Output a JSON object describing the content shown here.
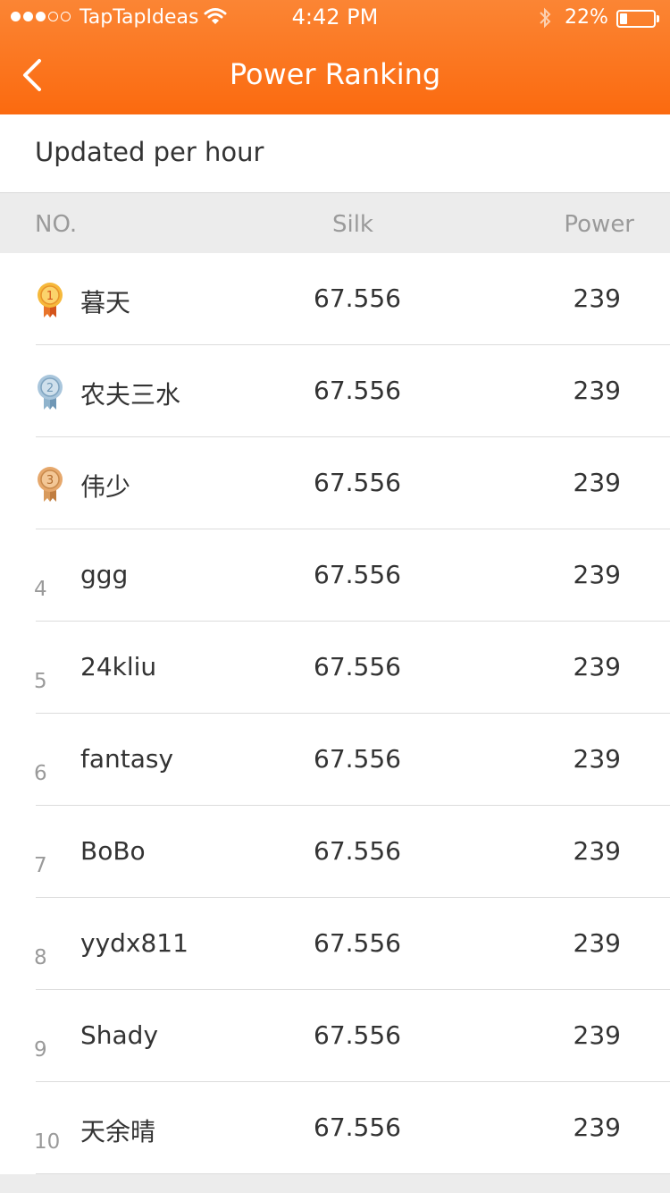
{
  "status_bar": {
    "carrier": "TapTapIdeas",
    "time": "4:42 PM",
    "battery": "22%",
    "signal_bars": 3,
    "battery_level": 0.22
  },
  "nav": {
    "title": "Power Ranking",
    "back_icon": "chevron-left-icon"
  },
  "subheader": "Updated per hour",
  "columns": {
    "no": "NO.",
    "silk": "Silk",
    "power": "Power"
  },
  "colors": {
    "accent": "#fb6a0f",
    "gold": "#f5a623",
    "silver": "#9bb8cf",
    "bronze": "#e0a46a"
  },
  "rows": [
    {
      "rank": "1",
      "medal": "gold-medal-icon",
      "medal_number": "1",
      "name": "暮天",
      "silk": "67.556",
      "power": "239"
    },
    {
      "rank": "2",
      "medal": "silver-medal-icon",
      "medal_number": "2",
      "name": "农夫三水",
      "silk": "67.556",
      "power": "239"
    },
    {
      "rank": "3",
      "medal": "bronze-medal-icon",
      "medal_number": "3",
      "name": "伟少",
      "silk": "67.556",
      "power": "239"
    },
    {
      "rank": "4",
      "name": "ggg",
      "silk": "67.556",
      "power": "239"
    },
    {
      "rank": "5",
      "name": "24kliu",
      "silk": "67.556",
      "power": "239"
    },
    {
      "rank": "6",
      "name": "fantasy",
      "silk": "67.556",
      "power": "239"
    },
    {
      "rank": "7",
      "name": "BoBo",
      "silk": "67.556",
      "power": "239"
    },
    {
      "rank": "8",
      "name": "yydx811",
      "silk": "67.556",
      "power": "239"
    },
    {
      "rank": "9",
      "name": "Shady",
      "silk": "67.556",
      "power": "239"
    },
    {
      "rank": "10",
      "name": "天余晴",
      "silk": "67.556",
      "power": "239"
    }
  ]
}
